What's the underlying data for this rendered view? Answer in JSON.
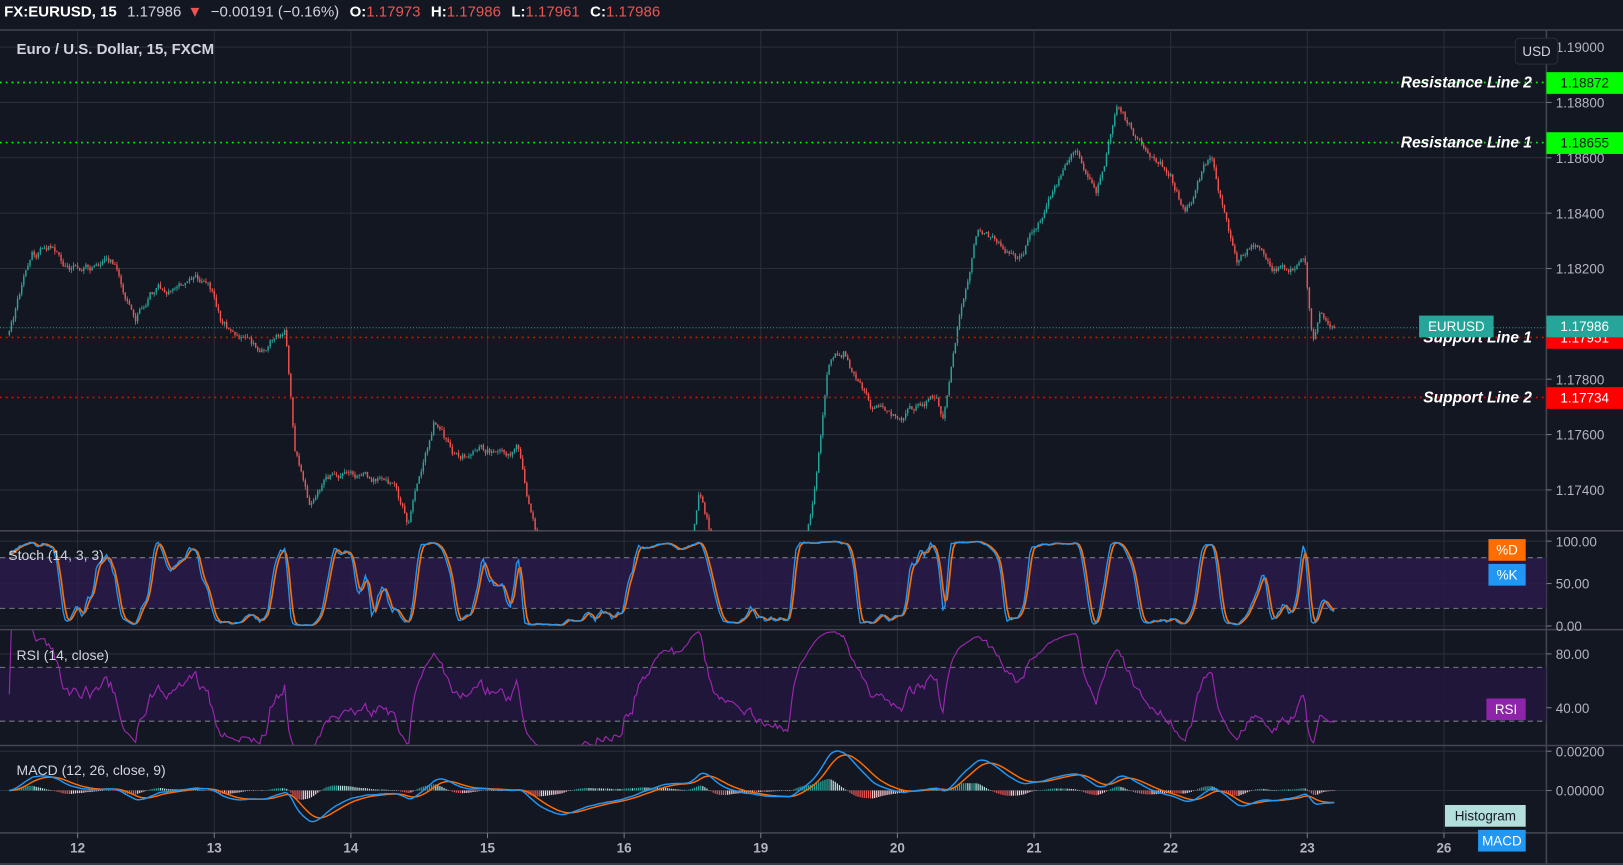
{
  "header": {
    "symbol": "FX:EURUSD, 15",
    "last": "1.17986",
    "change": "−0.00191 (−0.16%)",
    "o_label": "O:",
    "o": "1.17973",
    "h_label": "H:",
    "h": "1.17986",
    "l_label": "L:",
    "l": "1.17961",
    "c_label": "C:",
    "c": "1.17986"
  },
  "main_pane": {
    "title": "Euro / U.S. Dollar, 15, FXCM",
    "currency_button": "USD",
    "price_ticks": [
      "1.19000",
      "1.18800",
      "1.18600",
      "1.18400",
      "1.18200",
      "1.17800",
      "1.17600",
      "1.17400"
    ],
    "last_price_tag": {
      "symbol": "EURUSD",
      "value": "1.17986"
    },
    "levels": [
      {
        "name": "Resistance Line 2",
        "value": "1.18872",
        "color": "#00ff00"
      },
      {
        "name": "Resistance Line 1",
        "value": "1.18655",
        "color": "#00ff00"
      },
      {
        "name": "Support Line 1",
        "value": "1.17951",
        "color": "#ff0000"
      },
      {
        "name": "Support Line 2",
        "value": "1.17734",
        "color": "#ff0000"
      }
    ]
  },
  "stoch_pane": {
    "title": "Stoch (14, 3, 3)",
    "ticks": [
      "100.00",
      "50.00",
      "0.00"
    ],
    "d_label": "%D",
    "k_label": "%K"
  },
  "rsi_pane": {
    "title": "RSI (14, close)",
    "ticks": [
      "80.00",
      "40.00"
    ],
    "label": "RSI"
  },
  "macd_pane": {
    "title": "MACD (12, 26, close, 9)",
    "ticks": [
      "0.00200",
      "0.00000"
    ],
    "hist_label": "Histogram",
    "macd_label": "MACD"
  },
  "time_axis": [
    "12",
    "13",
    "14",
    "15",
    "16",
    "19",
    "20",
    "21",
    "22",
    "23",
    "26"
  ],
  "colors": {
    "up": "#26a69a",
    "down": "#ef5350",
    "k": "#2196f3",
    "d": "#ff6d00",
    "rsi": "#9c27b0",
    "bg": "#131722"
  },
  "chart_data": {
    "type": "candlestick",
    "title": "Euro / U.S. Dollar, 15, FXCM",
    "x_unit": "trading day (0 = 12th, 10 = 26th)",
    "ylim": [
      1.1725,
      1.1905
    ],
    "price_path": [
      [
        -0.5,
        1.1796
      ],
      [
        -0.34,
        1.1825
      ],
      [
        -0.19,
        1.1828
      ],
      [
        -0.08,
        1.182
      ],
      [
        0.27,
        1.1822
      ],
      [
        0.42,
        1.18
      ],
      [
        0.53,
        1.1812
      ],
      [
        0.95,
        1.1815
      ],
      [
        1.06,
        1.18
      ],
      [
        1.33,
        1.179
      ],
      [
        1.52,
        1.1798
      ],
      [
        1.59,
        1.1755
      ],
      [
        1.7,
        1.1733
      ],
      [
        1.86,
        1.1745
      ],
      [
        2.31,
        1.1742
      ],
      [
        2.42,
        1.1728
      ],
      [
        2.61,
        1.1765
      ],
      [
        2.76,
        1.1752
      ],
      [
        3.22,
        1.1755
      ],
      [
        3.33,
        1.1728
      ],
      [
        3.52,
        1.17
      ],
      [
        3.98,
        1.169
      ],
      [
        4.47,
        1.1715
      ],
      [
        4.55,
        1.1742
      ],
      [
        4.66,
        1.172
      ],
      [
        5.19,
        1.17
      ],
      [
        5.38,
        1.1735
      ],
      [
        5.49,
        1.1785
      ],
      [
        5.61,
        1.179
      ],
      [
        5.8,
        1.177
      ],
      [
        6.02,
        1.1766
      ],
      [
        6.29,
        1.1774
      ],
      [
        6.33,
        1.1764
      ],
      [
        6.44,
        1.18
      ],
      [
        6.59,
        1.1835
      ],
      [
        6.89,
        1.1823
      ],
      [
        7.08,
        1.1842
      ],
      [
        7.31,
        1.1862
      ],
      [
        7.46,
        1.185
      ],
      [
        7.61,
        1.1878
      ],
      [
        7.77,
        1.1865
      ],
      [
        8.0,
        1.1855
      ],
      [
        8.11,
        1.184
      ],
      [
        8.3,
        1.1862
      ],
      [
        8.49,
        1.182
      ],
      [
        8.6,
        1.183
      ],
      [
        8.75,
        1.182
      ],
      [
        8.98,
        1.1822
      ],
      [
        9.04,
        1.179
      ],
      [
        9.09,
        1.18
      ],
      [
        9.2,
        1.17986
      ]
    ],
    "indicators": [
      "Stoch (14, 3, 3)",
      "RSI (14, close)",
      "MACD (12, 26, close, 9)"
    ]
  }
}
